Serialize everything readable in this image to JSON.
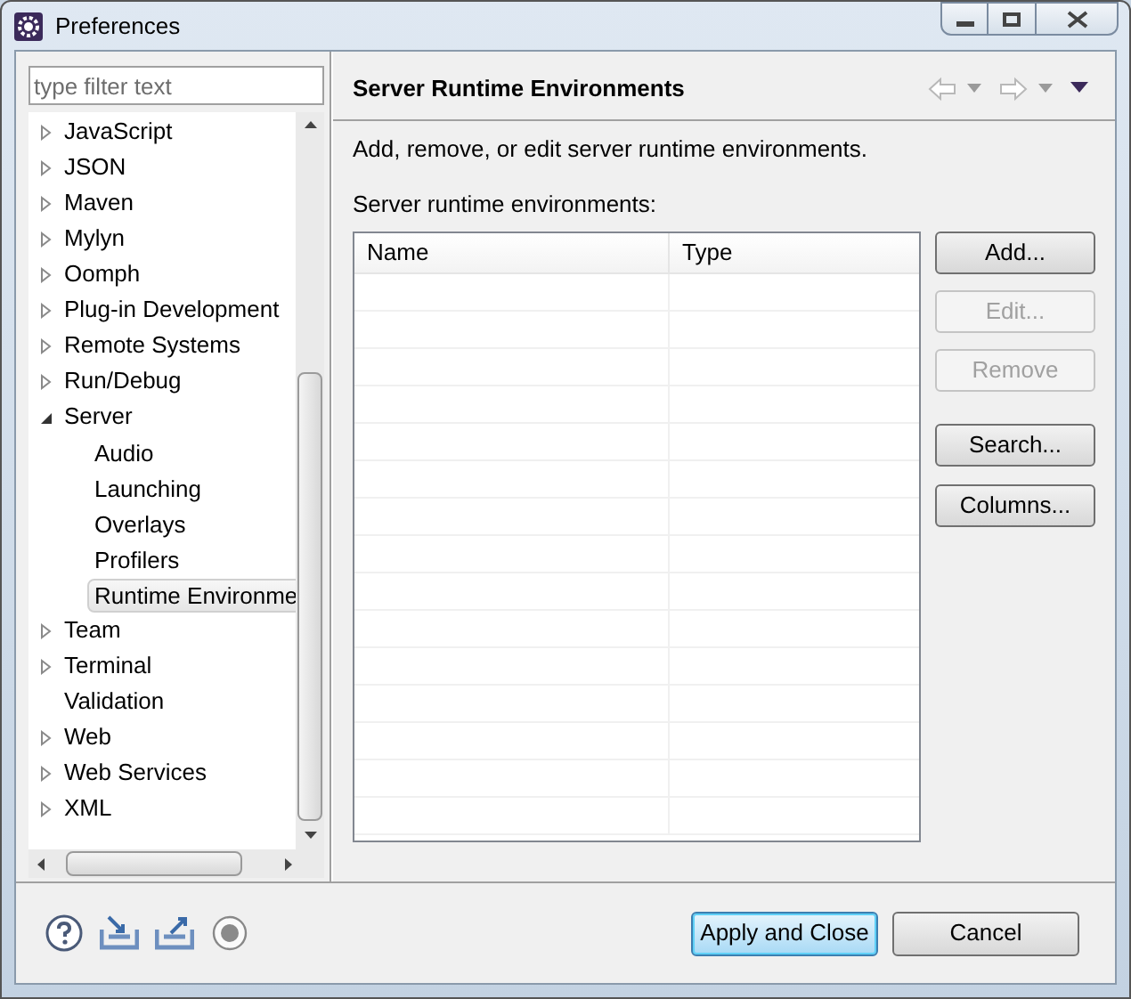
{
  "window": {
    "title": "Preferences"
  },
  "filter": {
    "placeholder": "type filter text"
  },
  "tree": [
    {
      "label": "JavaScript",
      "kind": "branch",
      "expanded": false
    },
    {
      "label": "JSON",
      "kind": "branch",
      "expanded": false
    },
    {
      "label": "Maven",
      "kind": "branch",
      "expanded": false
    },
    {
      "label": "Mylyn",
      "kind": "branch",
      "expanded": false
    },
    {
      "label": "Oomph",
      "kind": "branch",
      "expanded": false
    },
    {
      "label": "Plug-in Development",
      "kind": "branch",
      "expanded": false
    },
    {
      "label": "Remote Systems",
      "kind": "branch",
      "expanded": false
    },
    {
      "label": "Run/Debug",
      "kind": "branch",
      "expanded": false
    },
    {
      "label": "Server",
      "kind": "branch",
      "expanded": true,
      "children": [
        {
          "label": "Audio",
          "kind": "leaf",
          "selected": false
        },
        {
          "label": "Launching",
          "kind": "leaf",
          "selected": false
        },
        {
          "label": "Overlays",
          "kind": "leaf",
          "selected": false
        },
        {
          "label": "Profilers",
          "kind": "leaf",
          "selected": false
        },
        {
          "label": "Runtime Environme",
          "kind": "leaf",
          "selected": true
        }
      ]
    },
    {
      "label": "Team",
      "kind": "branch",
      "expanded": false
    },
    {
      "label": "Terminal",
      "kind": "branch",
      "expanded": false
    },
    {
      "label": "Validation",
      "kind": "leaf",
      "selected": false
    },
    {
      "label": "Web",
      "kind": "branch",
      "expanded": false
    },
    {
      "label": "Web Services",
      "kind": "branch",
      "expanded": false
    },
    {
      "label": "XML",
      "kind": "branch",
      "expanded": false
    }
  ],
  "page": {
    "title": "Server Runtime Environments",
    "description": "Add, remove, or edit server runtime environments.",
    "table_label": "Server runtime environments:"
  },
  "table": {
    "columns": [
      "Name",
      "Type"
    ]
  },
  "side_buttons": [
    {
      "label": "Add...",
      "disabled": false
    },
    {
      "label": "Edit...",
      "disabled": true
    },
    {
      "label": "Remove",
      "disabled": true
    },
    {
      "label": "Search...",
      "disabled": false
    },
    {
      "label": "Columns...",
      "disabled": false
    }
  ],
  "dialog_buttons": [
    {
      "label": "Apply and Close",
      "default": true
    },
    {
      "label": "Cancel",
      "default": false
    }
  ]
}
